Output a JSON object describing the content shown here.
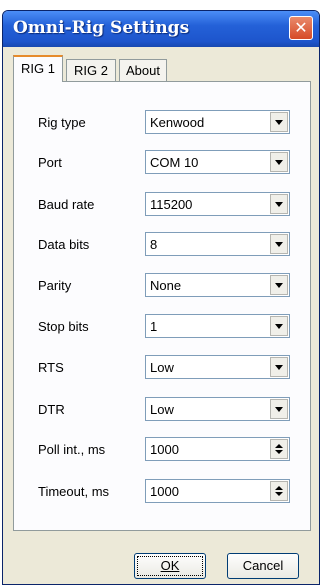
{
  "window": {
    "title": "Omni-Rig Settings",
    "close_glyph": "✕"
  },
  "tabs": [
    {
      "label": "RIG 1",
      "active": true
    },
    {
      "label": "RIG 2",
      "active": false
    },
    {
      "label": "About",
      "active": false
    }
  ],
  "fields": [
    {
      "label": "Rig type",
      "value": "Kenwood",
      "control": "dropdown"
    },
    {
      "label": "Port",
      "value": "COM 10",
      "control": "dropdown"
    },
    {
      "label": "Baud rate",
      "value": "115200",
      "control": "dropdown"
    },
    {
      "label": "Data bits",
      "value": "8",
      "control": "dropdown"
    },
    {
      "label": "Parity",
      "value": "None",
      "control": "dropdown"
    },
    {
      "label": "Stop bits",
      "value": "1",
      "control": "dropdown"
    },
    {
      "label": "RTS",
      "value": "Low",
      "control": "dropdown"
    },
    {
      "label": "DTR",
      "value": "Low",
      "control": "dropdown"
    },
    {
      "label": "Poll int., ms",
      "value": "1000",
      "control": "spinner"
    },
    {
      "label": "Timeout, ms",
      "value": "1000",
      "control": "spinner"
    }
  ],
  "buttons": {
    "ok_label": "OK",
    "cancel_label": "Cancel"
  }
}
